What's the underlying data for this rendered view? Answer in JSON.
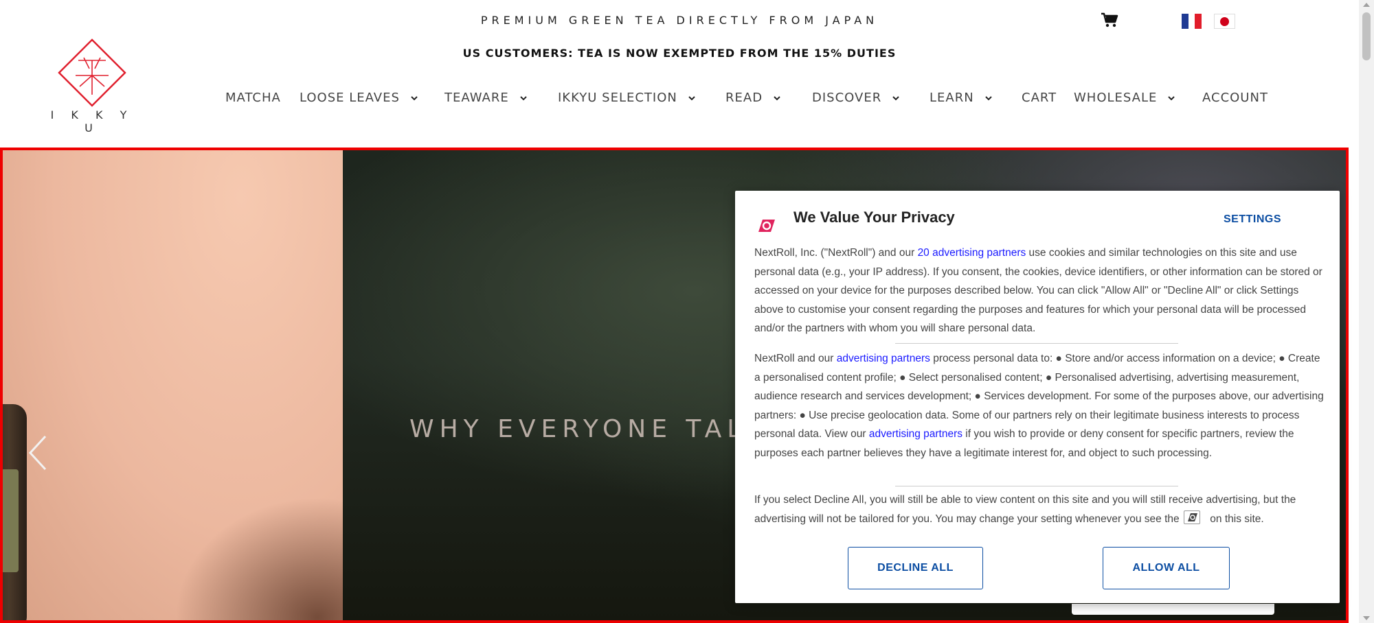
{
  "header": {
    "tagline": "PREMIUM GREEN TEA DIRECTLY FROM JAPAN",
    "notice": "US CUSTOMERS: TEA IS NOW EXEMPTED FROM THE 15% DUTIES",
    "logo_text": "I K K Y U",
    "cart_icon": "cart-icon",
    "flags": [
      "france-flag-icon",
      "japan-flag-icon"
    ]
  },
  "nav": {
    "items": [
      {
        "label": "MATCHA"
      },
      {
        "label": "LOOSE LEAVES"
      },
      {
        "label": "TEAWARE"
      },
      {
        "label": "IKKYU SELECTION"
      },
      {
        "label": "READ"
      },
      {
        "label": "DISCOVER"
      },
      {
        "label": "LEARN"
      },
      {
        "label": "CART"
      },
      {
        "label": "WHOLESALE"
      },
      {
        "label": "ACCOUNT"
      }
    ]
  },
  "hero": {
    "title": "WHY EVERYONE TAL",
    "highlight_color": "#ee0000"
  },
  "consent": {
    "title": "We Value Your Privacy",
    "settings_label": "SETTINGS",
    "p1_before": "NextRoll, Inc. (\"NextRoll\") and our ",
    "p1_link": "20 advertising partners",
    "p1_after": " use cookies and similar technologies on this site and use personal data (e.g., your IP address). If you consent, the cookies, device identifiers, or other information can be stored or accessed on your device for the purposes described below. You can click \"Allow All\" or \"Decline All\" or click Settings above to customise your consent regarding the purposes and features for which your personal data will be processed and/or the partners with whom you will share personal data.",
    "p2_before": "NextRoll and our ",
    "p2_link1": "advertising partners",
    "p2_middle": " process personal data to: ● Store and/or access information on a device; ● Create a personalised content profile; ● Select personalised content; ● Personalised advertising, advertising measurement, audience research and services development; ● Services development. For some of the purposes above, our advertising partners: ● Use precise geolocation data. Some of our partners rely on their legitimate business interests to process personal data. View our ",
    "p2_link2": "advertising partners",
    "p2_after": " if you wish to provide or deny consent for specific partners, review the purposes each partner believes they have a legitimate interest for, and object to such processing.",
    "p3_before": "If you select Decline All, you will still be able to view content on this site and you will still receive advertising, but the advertising will not be tailored for you. You may change your setting whenever you see the ",
    "p3_after": " on this site.",
    "decline_label": "DECLINE ALL",
    "allow_label": "ALLOW ALL",
    "brand_color": "#0b4da2",
    "link_color": "#1a1aff",
    "logo_color": "#e0245e"
  }
}
